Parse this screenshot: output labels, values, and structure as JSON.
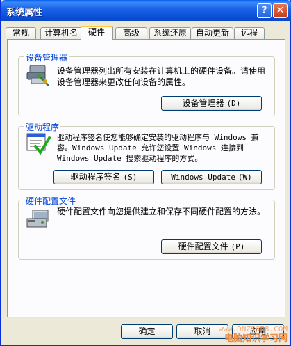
{
  "window": {
    "title": "系统属性"
  },
  "titlebar": {
    "help_glyph": "?",
    "close_glyph": "✕"
  },
  "tabs": [
    {
      "label": "常规"
    },
    {
      "label": "计算机名"
    },
    {
      "label": "硬件"
    },
    {
      "label": "高级"
    },
    {
      "label": "系统还原"
    },
    {
      "label": "自动更新"
    },
    {
      "label": "远程"
    }
  ],
  "active_tab": "硬件",
  "device_manager": {
    "title": "设备管理器",
    "description": "设备管理器列出所有安装在计算机上的硬件设备。请使用设备管理器来更改任何设备的属性。",
    "button_label": "设备管理器",
    "button_accel": "(D)"
  },
  "drivers": {
    "title": "驱动程序",
    "description": "驱动程序签名使您能够确定安装的驱动程序与 Windows 兼容。Windows Update 允许您设置 Windows 连接到 Windows Update 搜索驱动程序的方式。",
    "signing_button_label": "驱动程序签名",
    "signing_button_accel": "(S)",
    "update_button_label": "Windows Update",
    "update_button_accel": "(W)"
  },
  "hardware_profiles": {
    "title": "硬件配置文件",
    "description": "硬件配置文件向您提供建立和保存不同硬件配置的方法。",
    "button_label": "硬件配置文件",
    "button_accel": "(P)"
  },
  "footer": {
    "ok_label": "确定",
    "cancel_label": "取消",
    "apply_label": "应用"
  },
  "watermark": {
    "line1": "www.DNZS678.COM",
    "line2": "电脑知识学习网"
  },
  "colors": {
    "titlebar": "#0a5ef0",
    "group_title": "#0046d5",
    "close": "#c63b18",
    "tab_highlight": "#ffc83c"
  }
}
